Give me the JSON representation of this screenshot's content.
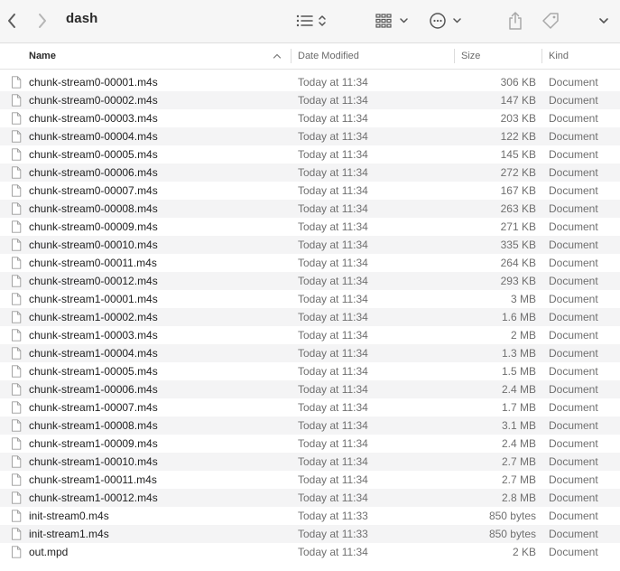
{
  "window": {
    "title": "dash"
  },
  "columns": {
    "name": "Name",
    "date": "Date Modified",
    "size": "Size",
    "kind": "Kind"
  },
  "files": [
    {
      "name": "chunk-stream0-00001.m4s",
      "date": "Today at 11:34",
      "size": "306 KB",
      "kind": "Document"
    },
    {
      "name": "chunk-stream0-00002.m4s",
      "date": "Today at 11:34",
      "size": "147 KB",
      "kind": "Document"
    },
    {
      "name": "chunk-stream0-00003.m4s",
      "date": "Today at 11:34",
      "size": "203 KB",
      "kind": "Document"
    },
    {
      "name": "chunk-stream0-00004.m4s",
      "date": "Today at 11:34",
      "size": "122 KB",
      "kind": "Document"
    },
    {
      "name": "chunk-stream0-00005.m4s",
      "date": "Today at 11:34",
      "size": "145 KB",
      "kind": "Document"
    },
    {
      "name": "chunk-stream0-00006.m4s",
      "date": "Today at 11:34",
      "size": "272 KB",
      "kind": "Document"
    },
    {
      "name": "chunk-stream0-00007.m4s",
      "date": "Today at 11:34",
      "size": "167 KB",
      "kind": "Document"
    },
    {
      "name": "chunk-stream0-00008.m4s",
      "date": "Today at 11:34",
      "size": "263 KB",
      "kind": "Document"
    },
    {
      "name": "chunk-stream0-00009.m4s",
      "date": "Today at 11:34",
      "size": "271 KB",
      "kind": "Document"
    },
    {
      "name": "chunk-stream0-00010.m4s",
      "date": "Today at 11:34",
      "size": "335 KB",
      "kind": "Document"
    },
    {
      "name": "chunk-stream0-00011.m4s",
      "date": "Today at 11:34",
      "size": "264 KB",
      "kind": "Document"
    },
    {
      "name": "chunk-stream0-00012.m4s",
      "date": "Today at 11:34",
      "size": "293 KB",
      "kind": "Document"
    },
    {
      "name": "chunk-stream1-00001.m4s",
      "date": "Today at 11:34",
      "size": "3 MB",
      "kind": "Document"
    },
    {
      "name": "chunk-stream1-00002.m4s",
      "date": "Today at 11:34",
      "size": "1.6 MB",
      "kind": "Document"
    },
    {
      "name": "chunk-stream1-00003.m4s",
      "date": "Today at 11:34",
      "size": "2 MB",
      "kind": "Document"
    },
    {
      "name": "chunk-stream1-00004.m4s",
      "date": "Today at 11:34",
      "size": "1.3 MB",
      "kind": "Document"
    },
    {
      "name": "chunk-stream1-00005.m4s",
      "date": "Today at 11:34",
      "size": "1.5 MB",
      "kind": "Document"
    },
    {
      "name": "chunk-stream1-00006.m4s",
      "date": "Today at 11:34",
      "size": "2.4 MB",
      "kind": "Document"
    },
    {
      "name": "chunk-stream1-00007.m4s",
      "date": "Today at 11:34",
      "size": "1.7 MB",
      "kind": "Document"
    },
    {
      "name": "chunk-stream1-00008.m4s",
      "date": "Today at 11:34",
      "size": "3.1 MB",
      "kind": "Document"
    },
    {
      "name": "chunk-stream1-00009.m4s",
      "date": "Today at 11:34",
      "size": "2.4 MB",
      "kind": "Document"
    },
    {
      "name": "chunk-stream1-00010.m4s",
      "date": "Today at 11:34",
      "size": "2.7 MB",
      "kind": "Document"
    },
    {
      "name": "chunk-stream1-00011.m4s",
      "date": "Today at 11:34",
      "size": "2.7 MB",
      "kind": "Document"
    },
    {
      "name": "chunk-stream1-00012.m4s",
      "date": "Today at 11:34",
      "size": "2.8 MB",
      "kind": "Document"
    },
    {
      "name": "init-stream0.m4s",
      "date": "Today at 11:33",
      "size": "850 bytes",
      "kind": "Document"
    },
    {
      "name": "init-stream1.m4s",
      "date": "Today at 11:33",
      "size": "850 bytes",
      "kind": "Document"
    },
    {
      "name": "out.mpd",
      "date": "Today at 11:34",
      "size": "2 KB",
      "kind": "Document"
    }
  ]
}
